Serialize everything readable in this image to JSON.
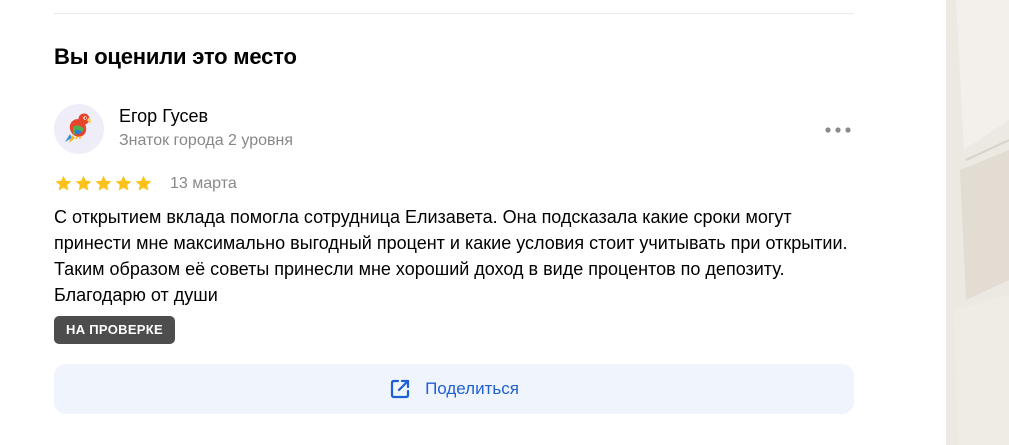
{
  "section": {
    "title": "Вы оценили это место"
  },
  "review": {
    "author": {
      "name": "Егор Гусев",
      "level": "Знаток города 2 уровня",
      "avatar_icon": "parrot-icon"
    },
    "rating": 5,
    "rating_max": 5,
    "date": "13 марта",
    "text": "С открытием вклада помогла сотрудница Елизавета. Она подсказала какие сроки могут принести мне максимально выгодный процент и какие условия стоит учитывать при открытии. Таким образом её советы принесли мне хороший доход в виде процентов по депозиту. Благодарю от души",
    "status_badge": "НА ПРОВЕРКЕ",
    "more_icon": "more-horizontal-icon"
  },
  "share": {
    "label": "Поделиться",
    "icon": "share-icon"
  },
  "colors": {
    "accent": "#1f5fd6",
    "star": "#fcc21b",
    "badge_bg": "#4d4d4d",
    "muted_text": "#888888",
    "share_bg": "#f0f4fc"
  }
}
